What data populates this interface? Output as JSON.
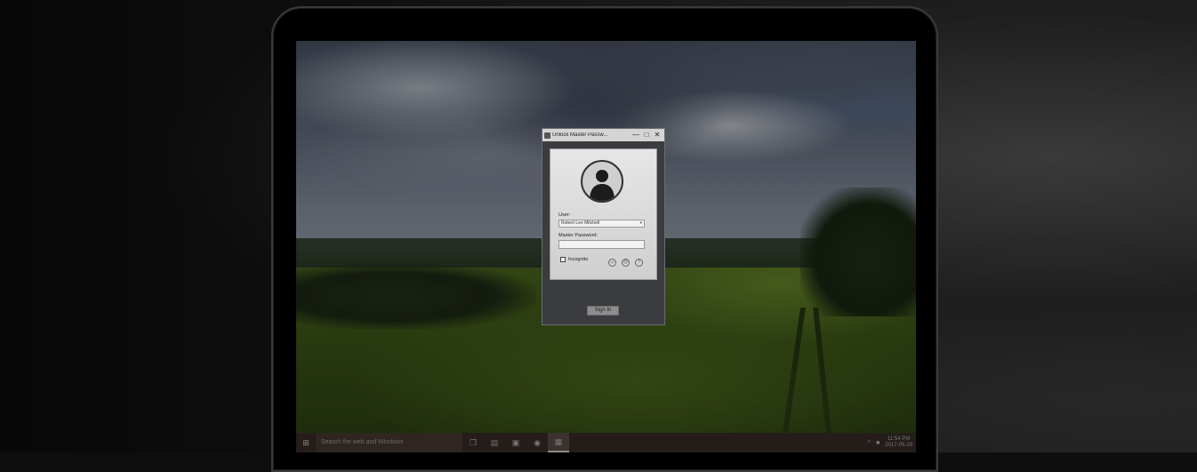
{
  "dialog": {
    "title": "Unlock Master Passw...",
    "minimize_glyph": "—",
    "maximize_glyph": "□",
    "close_glyph": "✕",
    "user_label": "User:",
    "user_value": "Robert Lee Mitchell",
    "password_label": "Master Password:",
    "password_value": "",
    "incognito_label": "Incognito",
    "signin_label": "Sign In",
    "icons": [
      "person-add-icon",
      "person-remove-icon",
      "help-icon"
    ],
    "icon_glyphs": [
      "☺",
      "☹",
      "?"
    ]
  },
  "taskbar": {
    "start_glyph": "⊞",
    "search_placeholder": "Search the web and Windows",
    "apps": [
      {
        "icon": "task-view-icon",
        "glyph": "❐"
      },
      {
        "icon": "file-explorer-icon",
        "glyph": "▤"
      },
      {
        "icon": "terminal-icon",
        "glyph": "▣"
      },
      {
        "icon": "chrome-icon",
        "glyph": "◉"
      },
      {
        "icon": "master-password-app-icon",
        "glyph": "▦"
      }
    ],
    "tray": {
      "chevron_glyph": "^",
      "notification_glyph": "■",
      "time": "11:54 PM",
      "date": "2017-05-29"
    }
  },
  "colors": {
    "taskbar": "#241d1a",
    "dialog_frame": "#3a3c3f",
    "panel": "#e6e6e6"
  }
}
